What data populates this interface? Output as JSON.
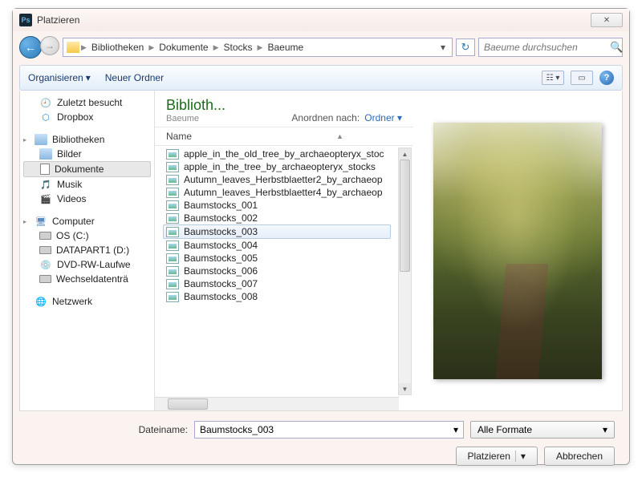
{
  "window": {
    "title": "Platzieren"
  },
  "breadcrumb": [
    "Bibliotheken",
    "Dokumente",
    "Stocks",
    "Baeume"
  ],
  "search": {
    "placeholder": "Baeume durchsuchen"
  },
  "toolbar": {
    "organize": "Organisieren",
    "newfolder": "Neuer Ordner"
  },
  "tree": {
    "recent": "Zuletzt besucht",
    "dropbox": "Dropbox",
    "libraries": "Bibliotheken",
    "pictures": "Bilder",
    "documents": "Dokumente",
    "music": "Musik",
    "videos": "Videos",
    "computer": "Computer",
    "drive_c": "OS (C:)",
    "drive_d": "DATAPART1 (D:)",
    "dvd": "DVD-RW-Laufwe",
    "removable": "Wechseldatenträ",
    "network": "Netzwerk"
  },
  "list": {
    "lib_title": "Biblioth...",
    "lib_sub": "Baeume",
    "arrange_label": "Anordnen nach:",
    "arrange_value": "Ordner",
    "col_name": "Name",
    "files": [
      "apple_in_the_old_tree_by_archaeopteryx_stoc",
      "apple_in_the_tree_by_archaeopteryx_stocks",
      "Autumn_leaves_Herbstblaetter2_by_archaeop",
      "Autumn_leaves_Herbstblaetter4_by_archaeop",
      "Baumstocks_001",
      "Baumstocks_002",
      "Baumstocks_003",
      "Baumstocks_004",
      "Baumstocks_005",
      "Baumstocks_006",
      "Baumstocks_007",
      "Baumstocks_008"
    ],
    "selected_index": 6
  },
  "footer": {
    "filename_label": "Dateiname:",
    "filename_value": "Baumstocks_003",
    "format": "Alle Formate",
    "place": "Platzieren",
    "cancel": "Abbrechen"
  }
}
